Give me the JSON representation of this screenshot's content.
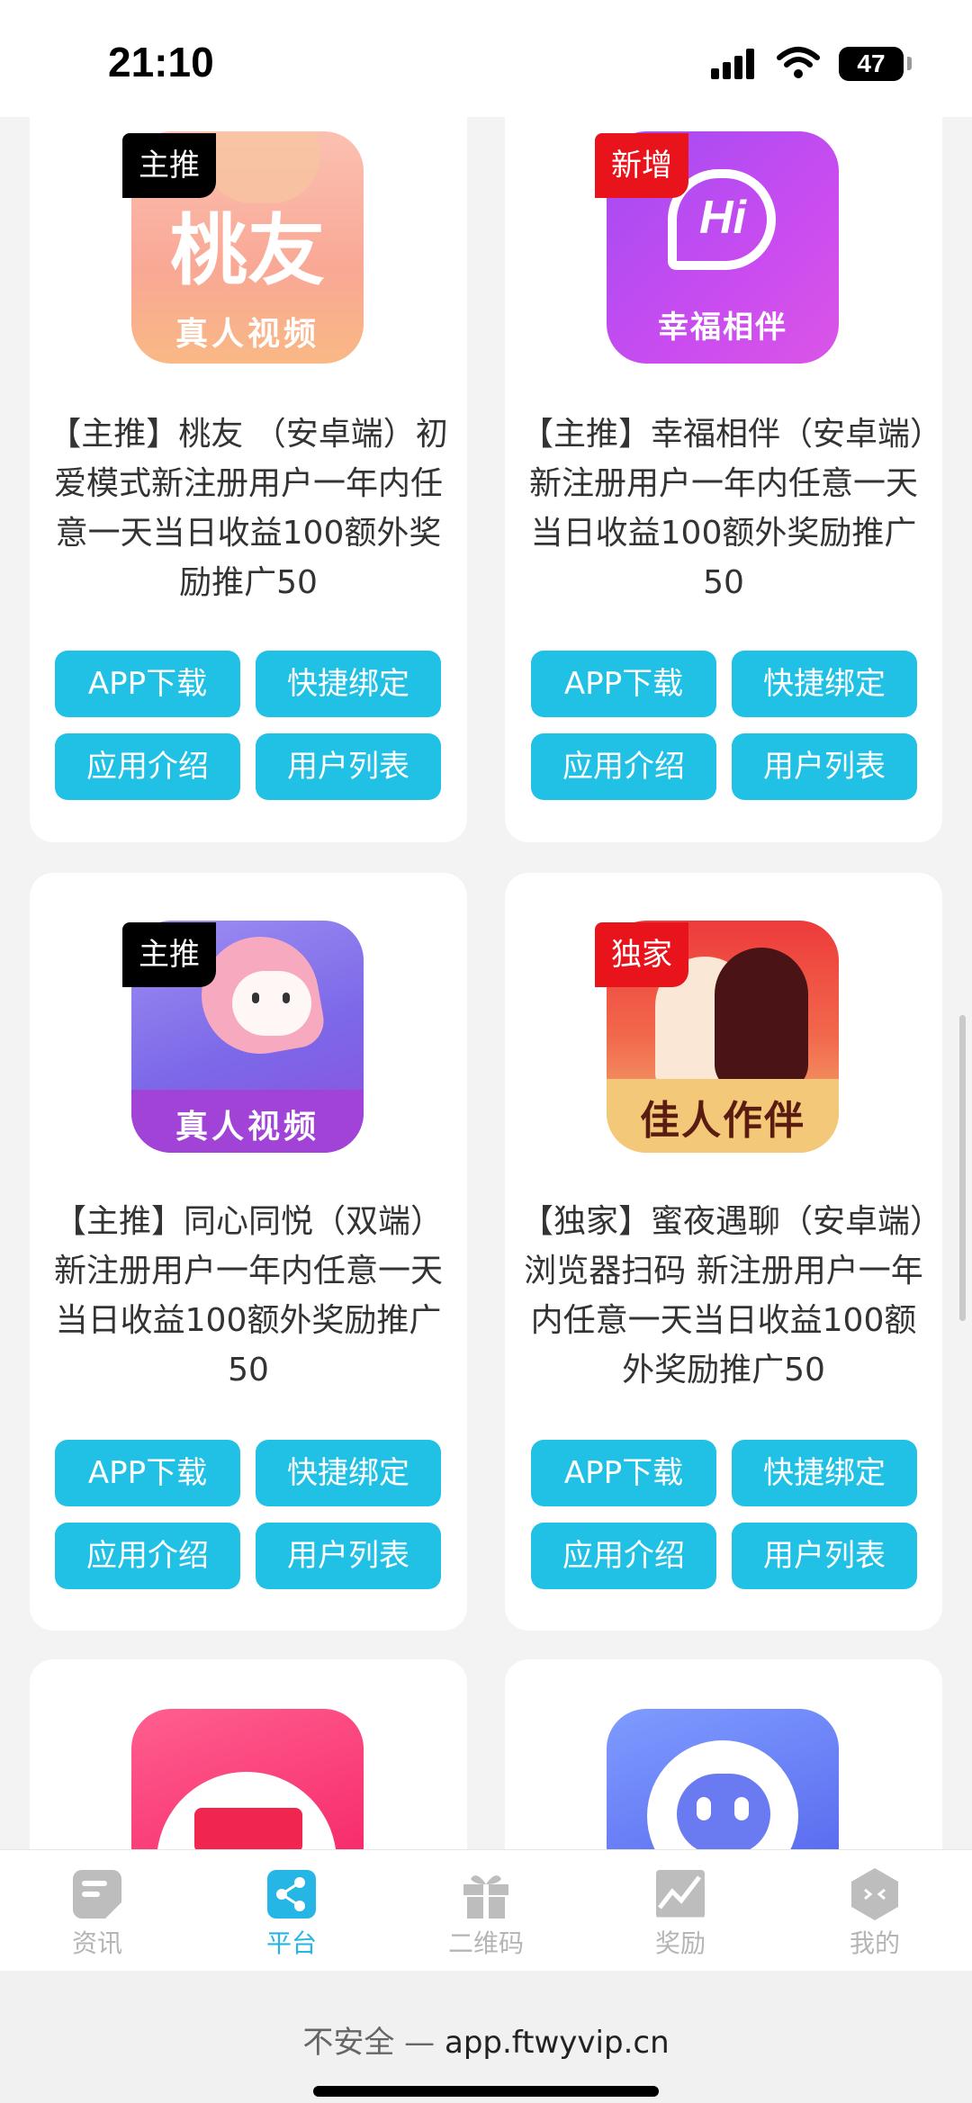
{
  "status": {
    "time": "21:10",
    "battery": "47"
  },
  "cards": [
    {
      "tag": "主推",
      "icon_text_top": "桃友",
      "icon_text_bottom": "真人视频",
      "title": "【主推】桃友 （安卓端）初爱模式新注册用户一年内任意一天当日收益100额外奖励推广50",
      "buttons": [
        "APP下载",
        "快捷绑定",
        "应用介绍",
        "用户列表"
      ]
    },
    {
      "tag": "新增",
      "icon_text_top": "Hi",
      "icon_text_bottom": "幸福相伴",
      "title": "【主推】幸福相伴（安卓端）新注册用户一年内任意一天当日收益100额外奖励推广50",
      "buttons": [
        "APP下载",
        "快捷绑定",
        "应用介绍",
        "用户列表"
      ]
    },
    {
      "tag": "主推",
      "icon_text_top": "",
      "icon_text_bottom": "真人视频",
      "title": "【主推】同心同悦（双端） 新注册用户一年内任意一天当日收益100额外奖励推广50",
      "buttons": [
        "APP下载",
        "快捷绑定",
        "应用介绍",
        "用户列表"
      ]
    },
    {
      "tag": "独家",
      "icon_text_top": "",
      "icon_text_bottom": "佳人作伴",
      "title": "【独家】蜜夜遇聊（安卓端）浏览器扫码 新注册用户一年内任意一天当日收益100额外奖励推广50",
      "buttons": [
        "APP下载",
        "快捷绑定",
        "应用介绍",
        "用户列表"
      ]
    },
    {
      "tag": "",
      "icon_text_top": "",
      "icon_text_bottom": "",
      "title": "",
      "buttons": []
    },
    {
      "tag": "",
      "icon_text_top": "",
      "icon_text_bottom": "",
      "title": "",
      "buttons": []
    }
  ],
  "tabbar": {
    "items": [
      {
        "label": "资讯",
        "icon": "news-icon"
      },
      {
        "label": "平台",
        "icon": "share-icon"
      },
      {
        "label": "二维码",
        "icon": "gift-icon"
      },
      {
        "label": "奖励",
        "icon": "chart-icon"
      },
      {
        "label": "我的",
        "icon": "profile-icon"
      }
    ],
    "active": "平台"
  },
  "browser": {
    "insecure_label": "不安全 —",
    "url": "app.ftwyvip.cn"
  },
  "colors": {
    "accent": "#20c1e4",
    "tag_black": "#000000",
    "tag_red": "#e8131b"
  }
}
